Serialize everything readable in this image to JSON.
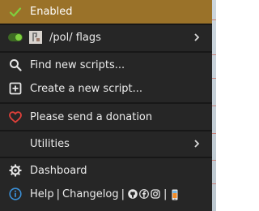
{
  "menu": {
    "enabled_label": "Enabled",
    "script": {
      "name": "/pol/ flags",
      "enabled": true
    },
    "find_label": "Find new scripts...",
    "create_label": "Create a new script...",
    "donate_label": "Please send a donation",
    "utilities_label": "Utilities",
    "dashboard_label": "Dashboard",
    "help_label": "Help",
    "sep1": "|",
    "changelog_label": "Changelog",
    "sep2": "|",
    "sep3": "|"
  },
  "colors": {
    "menu_bg": "#262626",
    "enabled_bg": "#9a7229",
    "check_green": "#7ed03f",
    "heart_red": "#e0403a",
    "info_blue": "#3a8fd6",
    "text": "#ececec"
  },
  "icons": [
    "check-icon",
    "toggle-icon",
    "favicon-icon",
    "search-icon",
    "plus-square-icon",
    "heart-icon",
    "gear-icon",
    "info-icon",
    "github-icon",
    "facebook-icon",
    "instagram-icon",
    "mobile-icon",
    "chevron-right-icon"
  ]
}
